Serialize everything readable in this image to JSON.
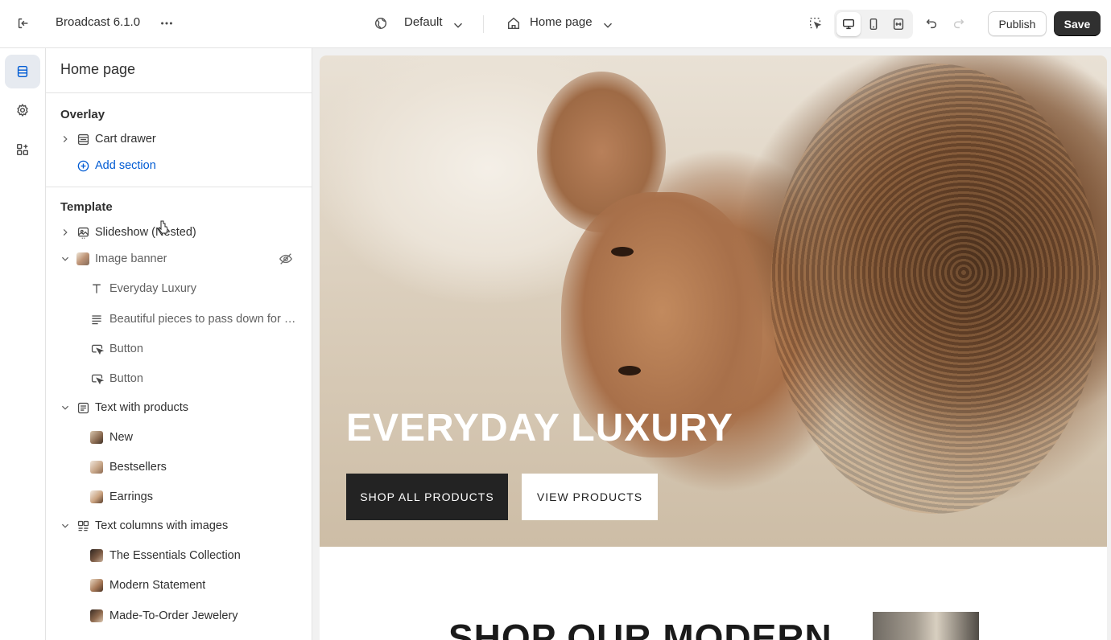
{
  "topbar": {
    "theme_name": "Broadcast 6.1.0",
    "theme_selector": "Default",
    "page_selector": "Home page",
    "publish_label": "Publish",
    "save_label": "Save"
  },
  "sidebar": {
    "title": "Home page",
    "overlay_group": {
      "title": "Overlay",
      "items": [
        {
          "label": "Cart drawer",
          "icon": "layout-icon"
        }
      ],
      "add_section_label": "Add section"
    },
    "template_group": {
      "title": "Template",
      "sections": [
        {
          "label": "Slideshow (Nested)",
          "icon": "slideshow-icon",
          "expanded": false
        },
        {
          "label": "Image banner",
          "icon": "image-thumbnail",
          "expanded": true,
          "hidden": true,
          "blocks": [
            {
              "label": "Everyday Luxury",
              "icon": "text-icon"
            },
            {
              "label": "Beautiful pieces to pass down for g...",
              "icon": "paragraph-icon"
            },
            {
              "label": "Button",
              "icon": "button-icon"
            },
            {
              "label": "Button",
              "icon": "button-icon"
            }
          ]
        },
        {
          "label": "Text with products",
          "icon": "text-block-icon",
          "expanded": true,
          "blocks": [
            {
              "label": "New",
              "icon": "image-thumbnail"
            },
            {
              "label": "Bestsellers",
              "icon": "image-thumbnail"
            },
            {
              "label": "Earrings",
              "icon": "image-thumbnail"
            }
          ]
        },
        {
          "label": "Text columns with images",
          "icon": "columns-icon",
          "expanded": true,
          "blocks": [
            {
              "label": "The Essentials Collection",
              "icon": "image-thumbnail"
            },
            {
              "label": "Modern Statement",
              "icon": "image-thumbnail"
            },
            {
              "label": "Made-To-Order Jewelery",
              "icon": "image-thumbnail"
            }
          ]
        }
      ]
    }
  },
  "preview": {
    "hero_title": "EVERYDAY LUXURY",
    "hero_button_1": "SHOP ALL PRODUCTS",
    "hero_button_2": "VIEW PRODUCTS",
    "next_heading": "SHOP OUR MODERN"
  },
  "colors": {
    "accent_link": "#005bd3",
    "save_button": "#303030",
    "hero_button_dark": "#232323"
  }
}
